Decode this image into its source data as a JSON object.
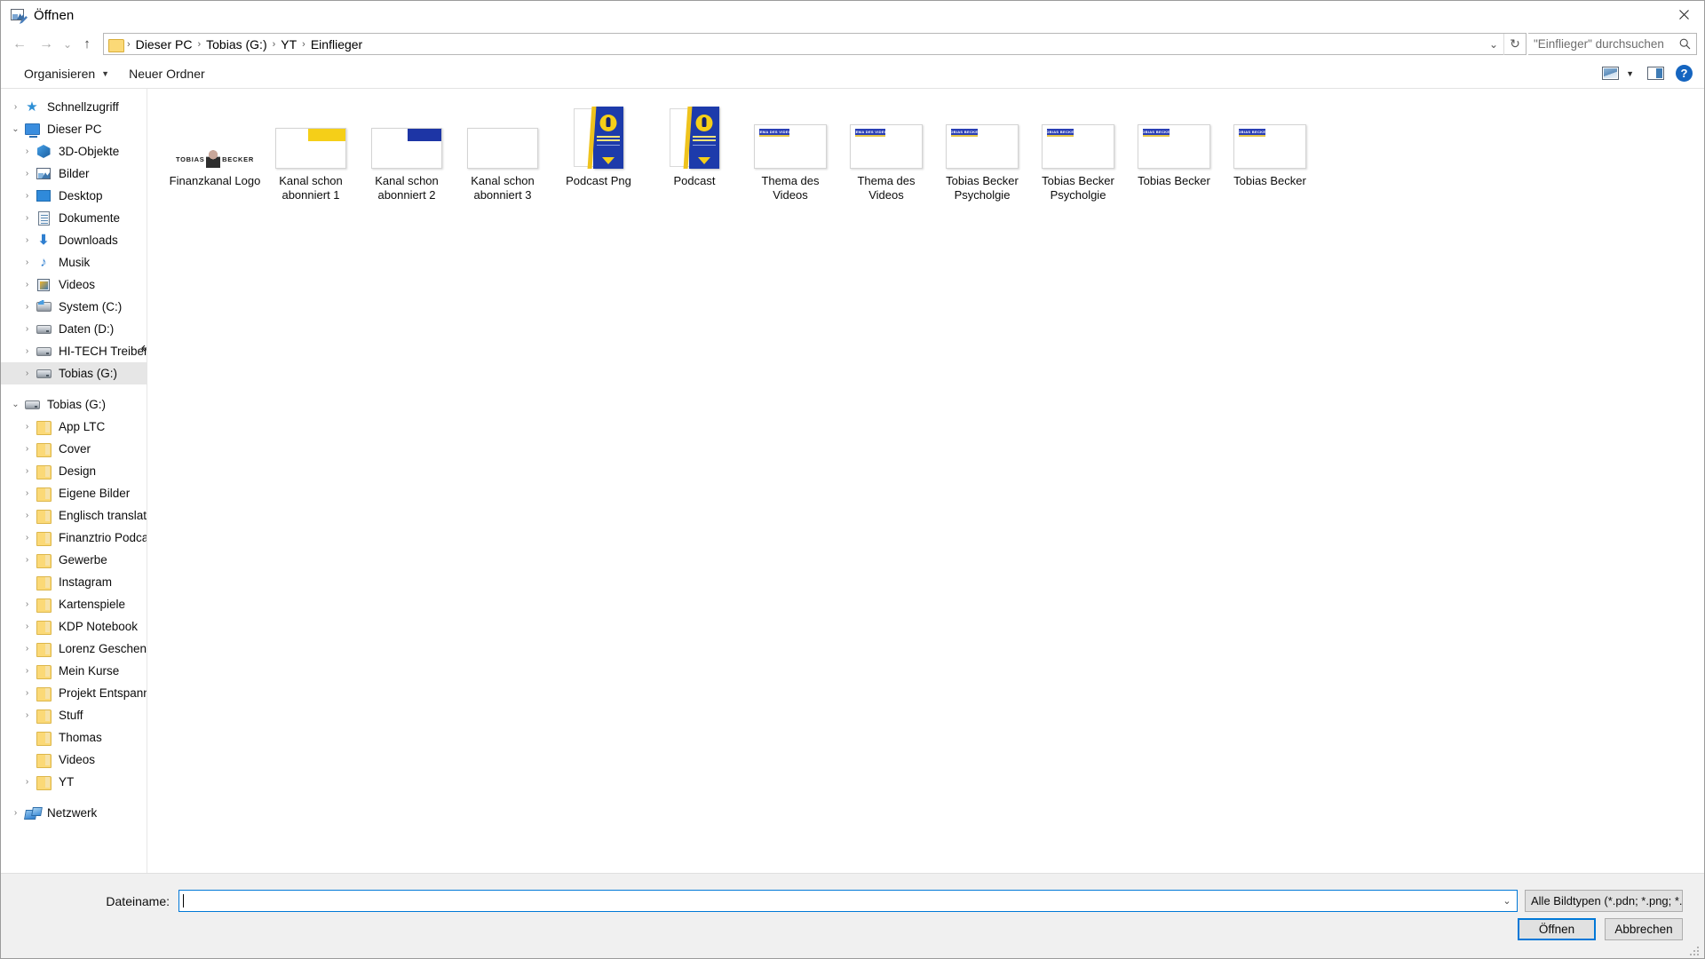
{
  "window": {
    "title": "Öffnen",
    "icon": "image-edit-icon",
    "close_label": "✕"
  },
  "nav": {
    "back_icon": "arrow-left-icon",
    "forward_icon": "arrow-right-icon",
    "recent_icon": "chevron-down-icon",
    "up_icon": "arrow-up-icon",
    "breadcrumbs": [
      "Dieser PC",
      "Tobias (G:)",
      "YT",
      "Einflieger"
    ],
    "separator": "›",
    "history_chevron": "⌄",
    "refresh_icon": "↻"
  },
  "search": {
    "placeholder": "\"Einflieger\" durchsuchen",
    "icon": "search-icon"
  },
  "toolbar": {
    "organize_label": "Organisieren",
    "organize_caret": "▼",
    "new_folder_label": "Neuer Ordner",
    "view_icon": "view-layout-icon",
    "view_caret": "▼",
    "preview_pane_icon": "preview-pane-icon",
    "help_label": "?"
  },
  "sidebar": {
    "items": [
      {
        "label": "Schnellzugriff",
        "icon": "star-icon",
        "indent": 0,
        "chevron": "collapsed",
        "selected": false,
        "kind": "star"
      },
      {
        "label": "Dieser PC",
        "icon": "computer-icon",
        "indent": 0,
        "chevron": "expanded",
        "selected": false,
        "kind": "pc"
      },
      {
        "label": "3D-Objekte",
        "icon": "3d-objects-icon",
        "indent": 1,
        "chevron": "collapsed",
        "selected": false,
        "kind": "3d"
      },
      {
        "label": "Bilder",
        "icon": "pictures-icon",
        "indent": 1,
        "chevron": "collapsed",
        "selected": false,
        "kind": "pics"
      },
      {
        "label": "Desktop",
        "icon": "desktop-icon",
        "indent": 1,
        "chevron": "collapsed",
        "selected": false,
        "kind": "desk"
      },
      {
        "label": "Dokumente",
        "icon": "documents-icon",
        "indent": 1,
        "chevron": "collapsed",
        "selected": false,
        "kind": "doc"
      },
      {
        "label": "Downloads",
        "icon": "downloads-icon",
        "indent": 1,
        "chevron": "collapsed",
        "selected": false,
        "kind": "down"
      },
      {
        "label": "Musik",
        "icon": "music-icon",
        "indent": 1,
        "chevron": "collapsed",
        "selected": false,
        "kind": "music"
      },
      {
        "label": "Videos",
        "icon": "videos-icon",
        "indent": 1,
        "chevron": "collapsed",
        "selected": false,
        "kind": "video"
      },
      {
        "label": "System (C:)",
        "icon": "system-drive-icon",
        "indent": 1,
        "chevron": "collapsed",
        "selected": false,
        "kind": "sys"
      },
      {
        "label": "Daten (D:)",
        "icon": "drive-icon",
        "indent": 1,
        "chevron": "collapsed",
        "selected": false,
        "kind": "hdd"
      },
      {
        "label": "HI-TECH Treiber (E:)",
        "icon": "drive-icon",
        "indent": 1,
        "chevron": "collapsed",
        "selected": false,
        "kind": "hdd"
      },
      {
        "label": "Tobias (G:)",
        "icon": "drive-icon",
        "indent": 1,
        "chevron": "collapsed",
        "selected": true,
        "kind": "hdd"
      },
      {
        "label": "",
        "icon": "",
        "indent": 0,
        "chevron": "none",
        "selected": false,
        "kind": "spacer"
      },
      {
        "label": "Tobias (G:)",
        "icon": "drive-icon",
        "indent": 0,
        "chevron": "expanded",
        "selected": false,
        "kind": "hdd"
      },
      {
        "label": "App LTC",
        "icon": "folder-icon",
        "indent": 1,
        "chevron": "collapsed",
        "selected": false,
        "kind": "folder"
      },
      {
        "label": "Cover",
        "icon": "folder-icon",
        "indent": 1,
        "chevron": "collapsed",
        "selected": false,
        "kind": "folder"
      },
      {
        "label": "Design",
        "icon": "folder-icon",
        "indent": 1,
        "chevron": "collapsed",
        "selected": false,
        "kind": "folder"
      },
      {
        "label": "Eigene Bilder",
        "icon": "folder-icon",
        "indent": 1,
        "chevron": "collapsed",
        "selected": false,
        "kind": "folder"
      },
      {
        "label": "Englisch translate",
        "icon": "folder-icon",
        "indent": 1,
        "chevron": "collapsed",
        "selected": false,
        "kind": "folder"
      },
      {
        "label": "Finanztrio Podcast",
        "icon": "folder-icon",
        "indent": 1,
        "chevron": "collapsed",
        "selected": false,
        "kind": "folder"
      },
      {
        "label": "Gewerbe",
        "icon": "folder-icon",
        "indent": 1,
        "chevron": "collapsed",
        "selected": false,
        "kind": "folder"
      },
      {
        "label": "Instagram",
        "icon": "folder-icon",
        "indent": 1,
        "chevron": "none",
        "selected": false,
        "kind": "folder"
      },
      {
        "label": "Kartenspiele",
        "icon": "folder-icon",
        "indent": 1,
        "chevron": "collapsed",
        "selected": false,
        "kind": "folder"
      },
      {
        "label": "KDP Notebook",
        "icon": "folder-icon",
        "indent": 1,
        "chevron": "collapsed",
        "selected": false,
        "kind": "folder"
      },
      {
        "label": "Lorenz Geschenk",
        "icon": "folder-icon",
        "indent": 1,
        "chevron": "collapsed",
        "selected": false,
        "kind": "folder"
      },
      {
        "label": "Mein Kurse",
        "icon": "folder-icon",
        "indent": 1,
        "chevron": "collapsed",
        "selected": false,
        "kind": "folder"
      },
      {
        "label": "Projekt Entspannun",
        "icon": "folder-icon",
        "indent": 1,
        "chevron": "collapsed",
        "selected": false,
        "kind": "folder"
      },
      {
        "label": "Stuff",
        "icon": "folder-icon",
        "indent": 1,
        "chevron": "collapsed",
        "selected": false,
        "kind": "folder"
      },
      {
        "label": "Thomas",
        "icon": "folder-icon",
        "indent": 1,
        "chevron": "none",
        "selected": false,
        "kind": "folder"
      },
      {
        "label": "Videos",
        "icon": "folder-icon",
        "indent": 1,
        "chevron": "none",
        "selected": false,
        "kind": "folder"
      },
      {
        "label": "YT",
        "icon": "folder-icon",
        "indent": 1,
        "chevron": "collapsed",
        "selected": false,
        "kind": "folder"
      },
      {
        "label": "",
        "icon": "",
        "indent": 0,
        "chevron": "none",
        "selected": false,
        "kind": "spacer"
      },
      {
        "label": "Netzwerk",
        "icon": "network-icon",
        "indent": 0,
        "chevron": "collapsed",
        "selected": false,
        "kind": "net"
      }
    ]
  },
  "files": [
    {
      "name": "Finanzkanal Logo",
      "thumb": "logo",
      "logo_left": "TOBIAS",
      "logo_right": "BECKER"
    },
    {
      "name": "Kanal schon abonniert 1",
      "thumb": "banner-yellow"
    },
    {
      "name": "Kanal schon abonniert 2",
      "thumb": "banner-blue"
    },
    {
      "name": "Kanal schon abonniert 3",
      "thumb": "banner-blank"
    },
    {
      "name": "Podcast Png",
      "thumb": "podcast"
    },
    {
      "name": "Podcast",
      "thumb": "podcast"
    },
    {
      "name": "Thema des Videos",
      "thumb": "slide",
      "badge": "THEMA DES VIDEOS",
      "badge_width": "wide"
    },
    {
      "name": "Thema des Videos",
      "thumb": "slide",
      "badge": "THEMA DES VIDEOS",
      "badge_width": "wide"
    },
    {
      "name": "Tobias Becker Psycholgie",
      "thumb": "slide",
      "badge": "TOBIAS BECKER",
      "badge_width": "narrow"
    },
    {
      "name": "Tobias Becker Psycholgie",
      "thumb": "slide",
      "badge": "TOBIAS BECKER",
      "badge_width": "narrow"
    },
    {
      "name": "Tobias Becker",
      "thumb": "slide",
      "badge": "TOBIAS BECKER",
      "badge_width": "narrow"
    },
    {
      "name": "Tobias Becker",
      "thumb": "slide",
      "badge": "TOBIAS BECKER",
      "badge_width": "narrow"
    }
  ],
  "footer": {
    "filename_label": "Dateiname:",
    "filename_value": "",
    "filename_dropdown_icon": "⌄",
    "filetype_value": "Alle Bildtypen (*.pdn; *.png; *.jp",
    "filetype_chevron": "⌄",
    "open_button": "Öffnen",
    "cancel_button": "Abbrechen"
  }
}
